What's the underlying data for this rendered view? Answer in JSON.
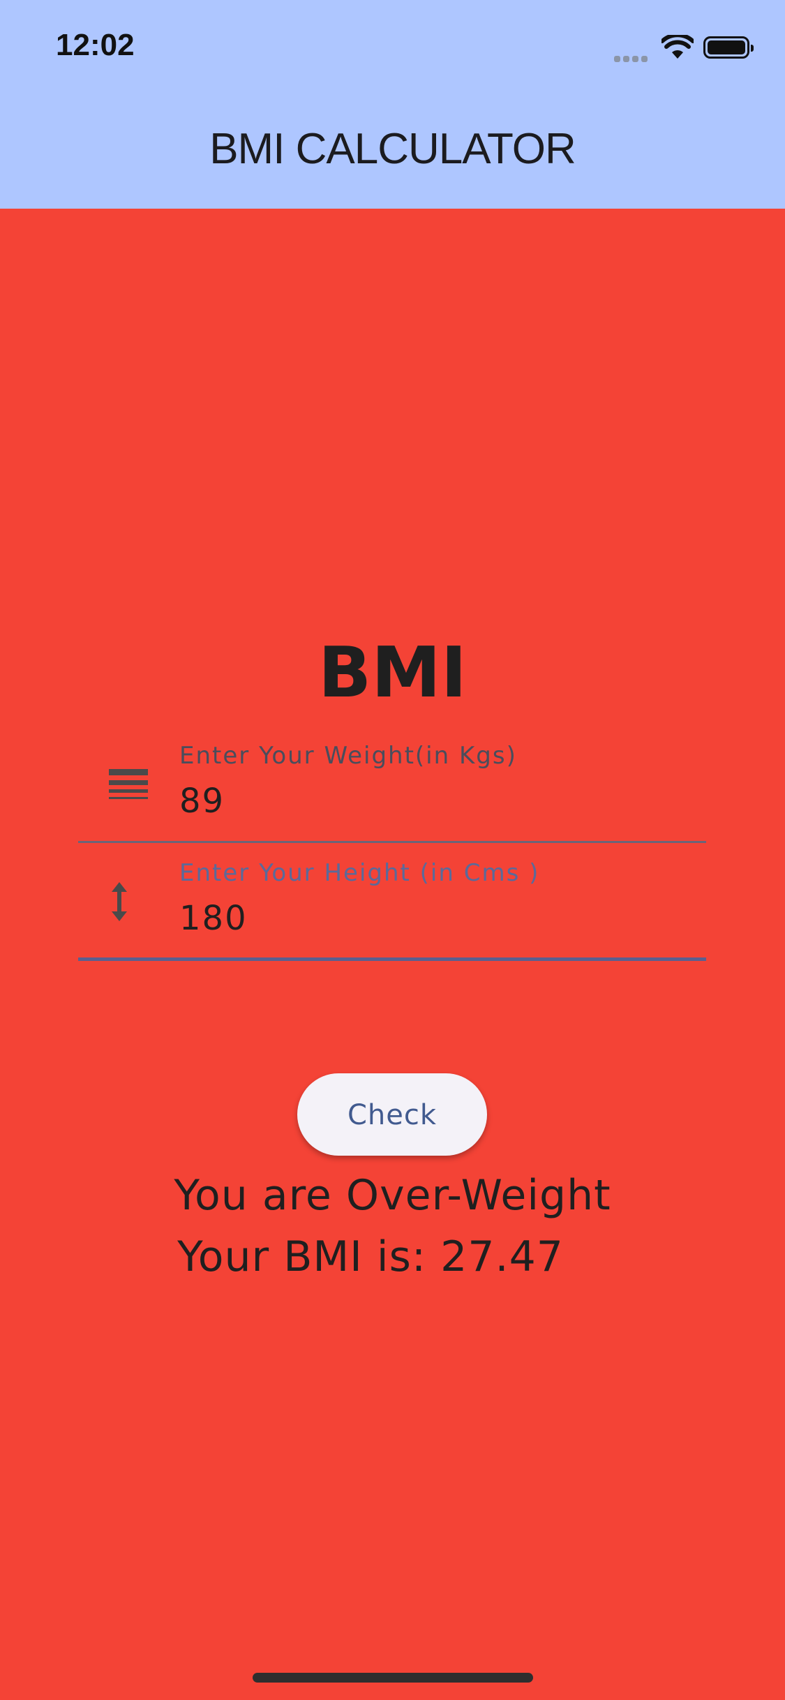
{
  "status_bar": {
    "time": "12:02",
    "icons": [
      "cellular-signal-icon",
      "wifi-icon",
      "battery-icon"
    ]
  },
  "app_bar": {
    "title": "BMI CALCULATOR",
    "background_color": "#AEC6FF"
  },
  "main": {
    "background_color": "#F44336",
    "heading": "BMI",
    "weight_field": {
      "icon": "line-weight-icon",
      "label": "Enter  Your Weight(in Kgs)",
      "value": "89"
    },
    "height_field": {
      "icon": "height-icon",
      "label": "Enter Your Height (in Cms )",
      "value": "180"
    },
    "check_button": {
      "label": "Check",
      "text_color": "#415A8F"
    },
    "result": {
      "status": "You are Over-Weight",
      "bmi_line": "Your BMI is: 27.47"
    }
  }
}
